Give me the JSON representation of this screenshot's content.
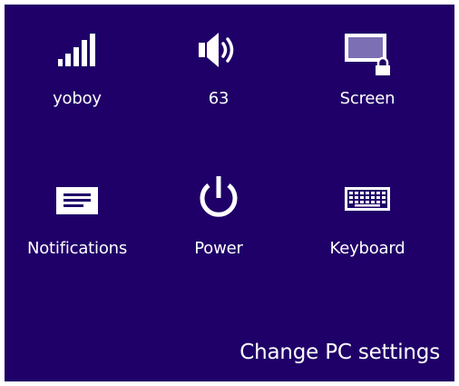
{
  "settings_panel": {
    "tiles": [
      {
        "label": "yoboy",
        "icon": "network-signal-icon"
      },
      {
        "label": "63",
        "icon": "volume-icon"
      },
      {
        "label": "Screen",
        "icon": "screen-lock-icon"
      },
      {
        "label": "Notifications",
        "icon": "notifications-icon"
      },
      {
        "label": "Power",
        "icon": "power-icon"
      },
      {
        "label": "Keyboard",
        "icon": "keyboard-icon"
      }
    ],
    "change_settings_label": "Change PC settings"
  },
  "colors": {
    "background": "#1f0068",
    "foreground": "#ffffff",
    "screen_fill": "#7d6fb4"
  }
}
